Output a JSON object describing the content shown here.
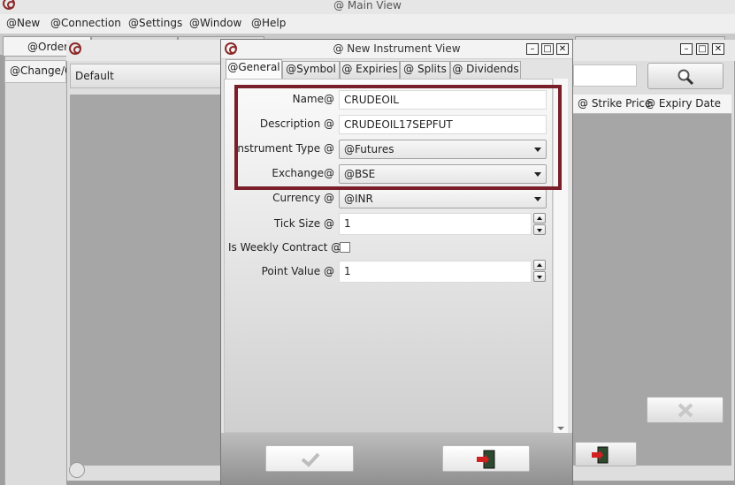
{
  "main_window": {
    "title": "@ Main View"
  },
  "menu": [
    "@New",
    "@Connection",
    "@Settings",
    "@Window",
    "@Help"
  ],
  "bg_tabs": {
    "orders": "@Orders"
  },
  "left_pane": {
    "label": "@Change/C"
  },
  "bg_window": {
    "dropdown_value": "Default",
    "grid_columns": [
      "@ Strike Price",
      "@ Expiry Date"
    ]
  },
  "dialog": {
    "title": "@ New Instrument View",
    "tabs": [
      "@General",
      "@Symbol",
      "@ Expiries",
      "@ Splits",
      "@ Dividends"
    ],
    "fields": {
      "name": {
        "label": "Name@",
        "value": "CRUDEOIL"
      },
      "description": {
        "label": "Description @",
        "value": "CRUDEOIL17SEPFUT"
      },
      "instrument_type": {
        "label": "Instrument Type @",
        "value": "@Futures"
      },
      "exchange": {
        "label": "Exchange@",
        "value": "@BSE"
      },
      "currency": {
        "label": "Currency @",
        "value": "@INR"
      },
      "tick_size": {
        "label": "Tick Size @",
        "value": "1"
      },
      "weekly": {
        "label": "Is Weekly Contract @",
        "checked": false
      },
      "point_value": {
        "label": "Point Value @",
        "value": "1"
      }
    }
  },
  "colors": {
    "highlight_border": "#7a1f2a",
    "logo": "#8c2a2a"
  },
  "icons": {
    "ok": "checkmark-icon",
    "cancel": "exit-door-icon",
    "search": "magnifier-icon",
    "delete": "x-icon"
  }
}
